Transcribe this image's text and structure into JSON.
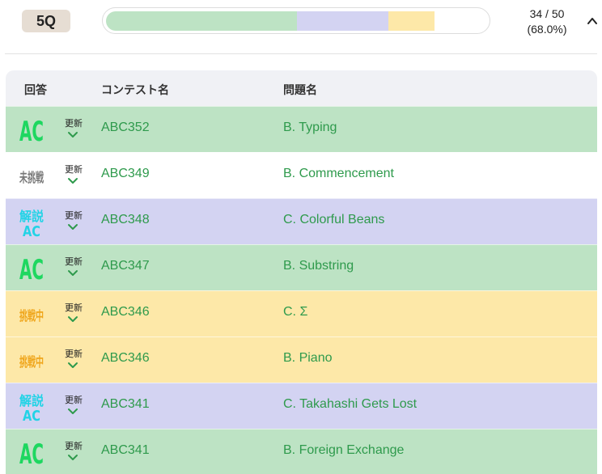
{
  "header": {
    "level_badge": "5Q",
    "progress_text_count": "34 / 50",
    "progress_text_percent": "(68.0%)",
    "progress": {
      "total": 50,
      "segments": [
        {
          "status": "AC",
          "count": 25,
          "color": "#bde3c4"
        },
        {
          "status": "解説AC",
          "count": 12,
          "color": "#d3d3f2"
        },
        {
          "status": "挑戦中",
          "count": 6,
          "color": "#fde8a8"
        }
      ]
    },
    "collapse_icon": "chevron-up-icon"
  },
  "table": {
    "columns": {
      "status": "回答",
      "contest": "コンテスト名",
      "problem": "問題名"
    },
    "update_label": "更新",
    "rows": [
      {
        "status": "AC",
        "status_color": "#1ed760",
        "row_color": "#bde3c4",
        "contest": "ABC352",
        "problem": "B. Typing"
      },
      {
        "status": "未挑戦",
        "status_color": "#777777",
        "row_color": "#ffffff",
        "contest": "ABC349",
        "problem": "B. Commencement"
      },
      {
        "status": "解説AC",
        "status_color": "#22d3e6",
        "row_color": "#d3d3f2",
        "contest": "ABC348",
        "problem": "C. Colorful Beans"
      },
      {
        "status": "AC",
        "status_color": "#1ed760",
        "row_color": "#bde3c4",
        "contest": "ABC347",
        "problem": "B. Substring"
      },
      {
        "status": "挑戦中",
        "status_color": "#efa51a",
        "row_color": "#fde8a8",
        "contest": "ABC346",
        "problem": "C. Σ"
      },
      {
        "status": "挑戦中",
        "status_color": "#efa51a",
        "row_color": "#fde8a8",
        "contest": "ABC346",
        "problem": "B. Piano"
      },
      {
        "status": "解説AC",
        "status_color": "#22d3e6",
        "row_color": "#d3d3f2",
        "contest": "ABC341",
        "problem": "C. Takahashi Gets Lost"
      },
      {
        "status": "AC",
        "status_color": "#1ed760",
        "row_color": "#bde3c4",
        "contest": "ABC341",
        "problem": "B. Foreign Exchange"
      }
    ]
  },
  "colors": {
    "link_green": "#2e9a4c"
  }
}
